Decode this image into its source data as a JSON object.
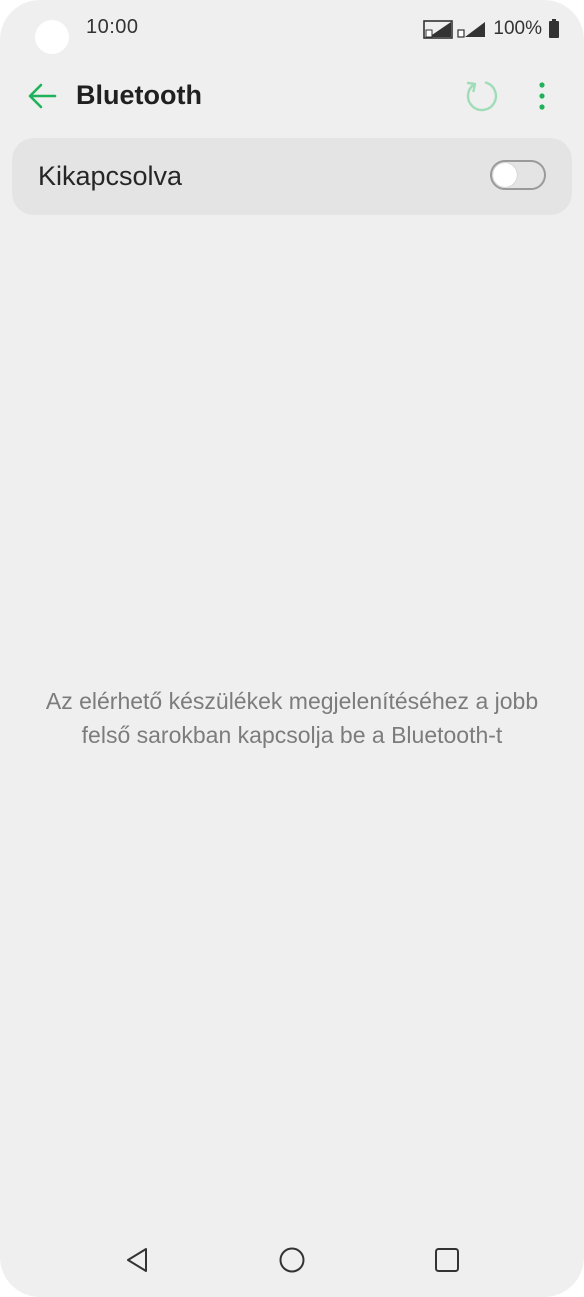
{
  "status_bar": {
    "time": "10:00",
    "battery": "100%",
    "icons": [
      "sim1-signal-icon",
      "sim2-signal-icon",
      "battery-icon"
    ]
  },
  "app_bar": {
    "title": "Bluetooth",
    "back_icon": "arrow-left-icon",
    "refresh_icon": "refresh-icon",
    "more_icon": "more-vertical-icon"
  },
  "toggle": {
    "label": "Kikapcsolva",
    "state": "off"
  },
  "empty_message": "Az elérhető készülékek megjelenítéséhez a jobb felső sarokban kapcsolja be a Bluetooth-t",
  "navigation": {
    "icons": [
      "back-triangle-icon",
      "home-circle-icon",
      "recents-square-icon"
    ]
  },
  "colors": {
    "accent": "#1fb25a",
    "accent_disabled": "#9fdcb8",
    "background": "#efefef",
    "card": "#e4e4e4"
  }
}
